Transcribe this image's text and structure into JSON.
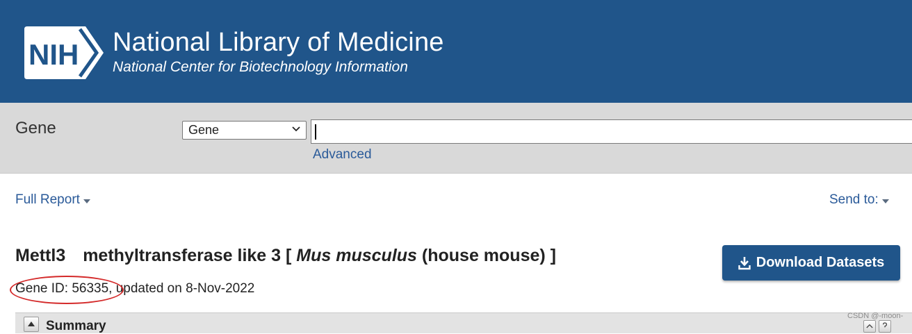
{
  "header": {
    "logo_text": "NIH",
    "title": "National Library of Medicine",
    "subtitle": "National Center for Biotechnology Information"
  },
  "search": {
    "db_label": "Gene",
    "db_selected": "Gene",
    "query": "",
    "advanced_label": "Advanced"
  },
  "report": {
    "format_label": "Full Report",
    "send_to_label": "Send to:"
  },
  "gene": {
    "symbol": "Mettl3",
    "name_prefix": "methyltransferase like 3 [",
    "organism_italic": "Mus musculus",
    "organism_suffix": "(house mouse) ]",
    "meta": "Gene ID: 56335, updated on 8-Nov-2022"
  },
  "download_button": {
    "label": "Download Datasets"
  },
  "summary": {
    "label": "Summary"
  },
  "watermark": {
    "text": "CSDN @-moon-"
  },
  "colors": {
    "header_bg": "#20558a",
    "search_bg": "#d9d9d9",
    "link": "#2a5a99",
    "highlight_circle": "#d42a2a"
  }
}
